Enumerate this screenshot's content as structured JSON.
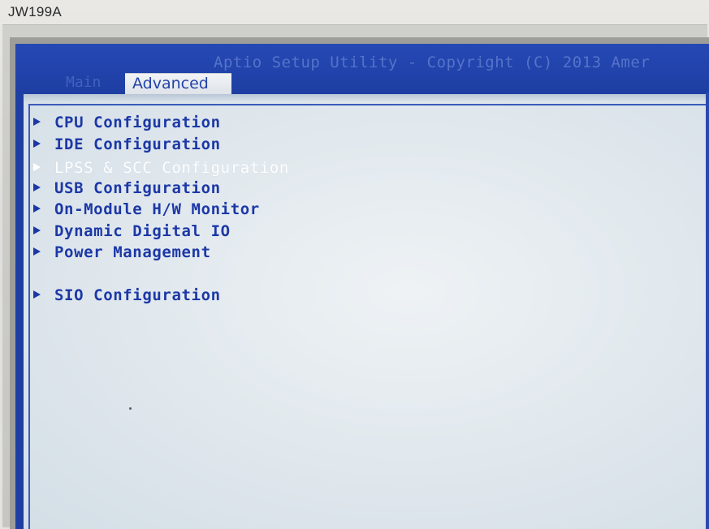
{
  "bezel": {
    "device_label": "JW199A"
  },
  "header": {
    "title": "Aptio Setup Utility - Copyright (C) 2013 Amer",
    "version_text": "",
    "tabs": [
      {
        "label": "Main",
        "active": false
      },
      {
        "label": "Advanced",
        "active": true
      }
    ]
  },
  "menu": {
    "items": [
      {
        "label": "CPU Configuration",
        "dimmed": false
      },
      {
        "label": "IDE Configuration",
        "dimmed": false
      },
      {
        "label": "LPSS & SCC Configuration",
        "dimmed": true
      },
      {
        "label": "USB Configuration",
        "dimmed": false
      },
      {
        "label": "On-Module H/W Monitor",
        "dimmed": false
      },
      {
        "label": "Dynamic Digital IO",
        "dimmed": false
      },
      {
        "label": "Power Management",
        "dimmed": false
      },
      {
        "label": "SIO Configuration",
        "dimmed": false
      }
    ]
  },
  "colors": {
    "screen_blue": "#1d3fa3",
    "menu_text": "#1c38a6",
    "dimmed_text": "#ffffff",
    "panel_bg": "#e2e9ee"
  }
}
